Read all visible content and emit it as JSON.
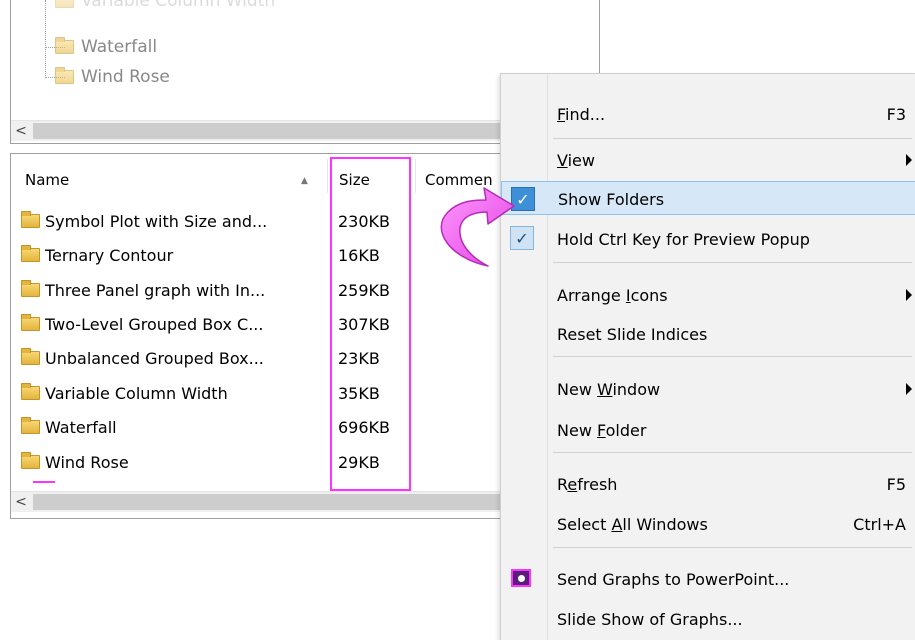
{
  "tree": {
    "ghost_item": "Variable Column Width",
    "items": [
      "Waterfall",
      "Wind Rose"
    ]
  },
  "list": {
    "headers": {
      "name": "Name",
      "size": "Size",
      "comments": "Commen"
    },
    "rows": [
      {
        "name": "Symbol Plot with Size and...",
        "size": "230KB"
      },
      {
        "name": "Ternary Contour",
        "size": "16KB"
      },
      {
        "name": "Three Panel graph with In...",
        "size": "259KB"
      },
      {
        "name": "Two-Level Grouped Box C...",
        "size": "307KB"
      },
      {
        "name": "Unbalanced Grouped Box...",
        "size": "23KB"
      },
      {
        "name": "Variable Column Width",
        "size": "35KB"
      },
      {
        "name": "Waterfall",
        "size": "696KB"
      },
      {
        "name": "Wind Rose",
        "size": "29KB"
      }
    ]
  },
  "scroll_arrow": "<",
  "menu": {
    "find": {
      "pre": "",
      "ul": "F",
      "post": "ind...",
      "shortcut": "F3"
    },
    "view": {
      "pre": "",
      "ul": "V",
      "post": "iew"
    },
    "show_folders": {
      "label": "Show Folders",
      "check": "✓"
    },
    "hold_ctrl": {
      "label": "Hold Ctrl Key for Preview Popup",
      "check": "✓"
    },
    "arrange_icons": {
      "pre": "Arrange ",
      "ul": "I",
      "post": "cons"
    },
    "reset_slide": {
      "label": "Reset Slide Indices"
    },
    "new_window": {
      "pre": "New ",
      "ul": "W",
      "post": "indow"
    },
    "new_folder": {
      "pre": "New ",
      "ul": "F",
      "post": "older"
    },
    "refresh": {
      "pre": "R",
      "ul": "e",
      "post": "fresh",
      "shortcut": "F5"
    },
    "select_all": {
      "pre": "Select ",
      "ul": "A",
      "post": "ll Windows",
      "shortcut": "Ctrl+A"
    },
    "send_ppt": {
      "label": "Send Graphs to PowerPoint..."
    },
    "slide_show": {
      "label": "Slide Show of Graphs..."
    }
  },
  "colors": {
    "highlight_border": "#ff33ff",
    "menu_highlight": "#d6e8f8",
    "check_active": "#3d8fd8",
    "arrow_fill": "#ff66ff"
  },
  "icons": {
    "folder": "folder-icon",
    "check": "check-icon",
    "submenu": "submenu-arrow-icon",
    "powerpoint": "powerpoint-icon",
    "annotation": "curved-arrow-icon"
  }
}
